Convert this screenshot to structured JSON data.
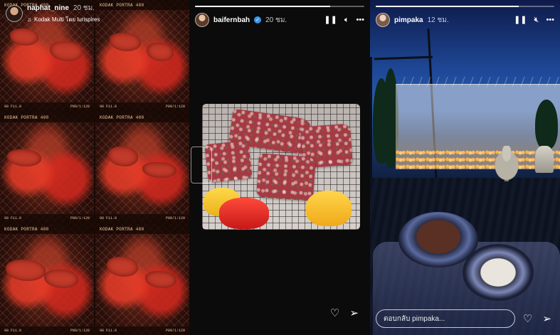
{
  "stories": [
    {
      "username": "naphat_nine",
      "time": "20 ชม.",
      "music": "Kodak Multi โดย lurispires",
      "progress": 0.0,
      "film_labels": {
        "stock": "KODAK PORTRA 400",
        "frame": "90 F11.0",
        "iso": "P80/1:120",
        "arrow": "→"
      }
    },
    {
      "username": "baifernbah",
      "time": "20 ชม.",
      "verified": true,
      "progress": 0.8,
      "icons": [
        "pause-icon",
        "mute-icon",
        "more-icon",
        "heart-icon",
        "send-icon"
      ]
    },
    {
      "username": "pimpaka",
      "time": "12 ชม.",
      "progress": 0.8,
      "reply_placeholder": "ตอบกลับ pimpaka...",
      "icons": [
        "pause-icon",
        "mute-icon",
        "more-icon",
        "heart-icon",
        "send-icon"
      ]
    }
  ],
  "colors": {
    "verified": "#3897f0",
    "accent_white": "#ffffff"
  }
}
